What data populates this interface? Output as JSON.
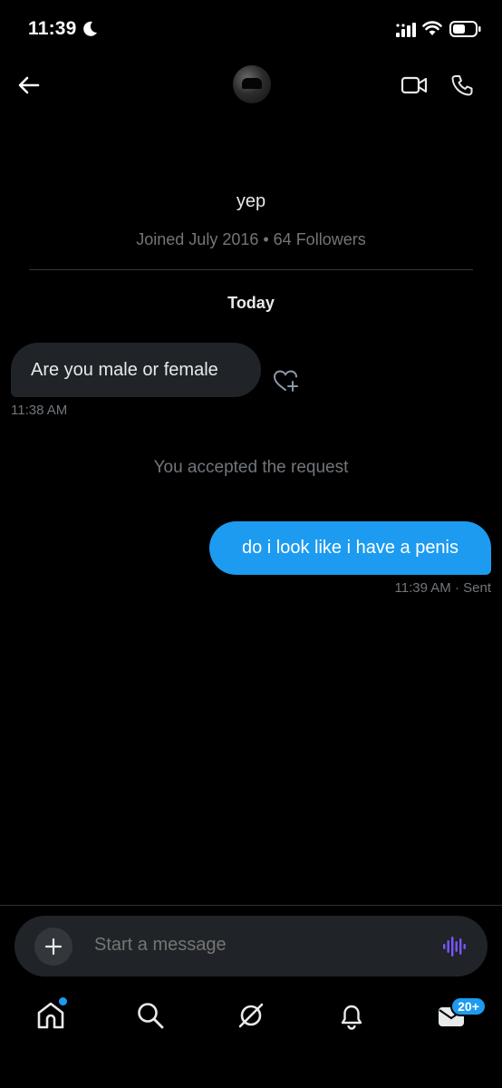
{
  "status_bar": {
    "time": "11:39"
  },
  "header": {
    "back_icon": "arrow-left-icon",
    "video_icon": "video-camera-icon",
    "call_icon": "phone-icon"
  },
  "profile": {
    "name": "yep",
    "meta": "Joined July 2016 • 64 Followers"
  },
  "conversation": {
    "day_label": "Today",
    "messages": [
      {
        "direction": "incoming",
        "text": "Are you male or female",
        "time": "11:38 AM"
      },
      {
        "direction": "system",
        "text": "You accepted the request"
      },
      {
        "direction": "outgoing",
        "text": "do i look like i have a penis",
        "time": "11:39 AM",
        "status": "· Sent"
      }
    ]
  },
  "composer": {
    "placeholder": "Start a message"
  },
  "nav": {
    "items": [
      "home-icon",
      "search-icon",
      "grok-icon",
      "bell-icon",
      "envelope-icon"
    ],
    "messages_badge": "20+"
  },
  "colors": {
    "accent": "#1d9bf0",
    "incoming_bubble": "#202327",
    "muted_text": "#71767b",
    "voice_purple": "#7856ff"
  }
}
